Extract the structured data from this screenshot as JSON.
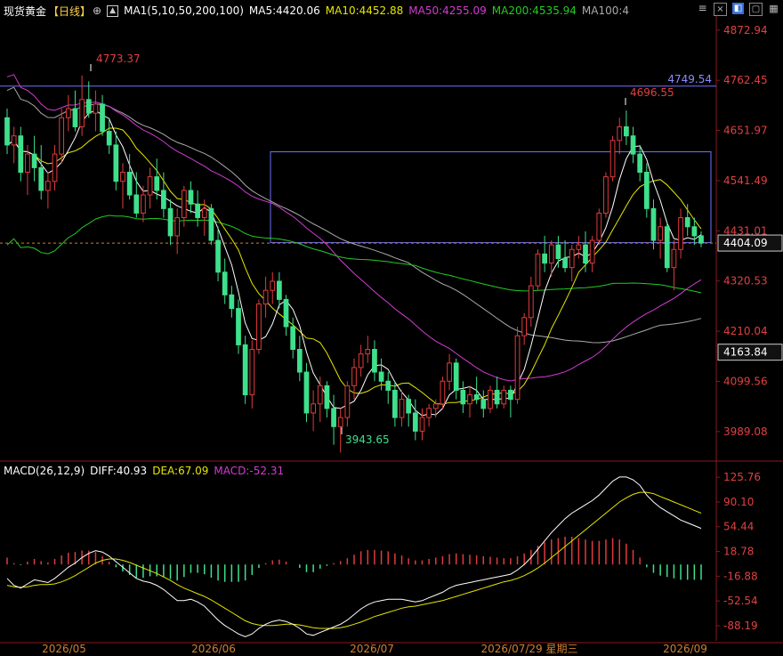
{
  "header": {
    "symbol": "现货黄金",
    "period": "【日线】",
    "ma_params": "MA1(5,10,50,200,100)",
    "ma5": "MA5:4420.06",
    "ma10": "MA10:4452.88",
    "ma50": "MA50:4255.09",
    "ma200": "MA200:4535.94",
    "ma100": "MA100:4",
    "colors": {
      "ma5": "#ffffff",
      "ma10": "#e6e600",
      "ma50": "#d23cd2",
      "ma200": "#22cc22",
      "ma100": "#aaaaaa"
    }
  },
  "toolbar": {
    "icons": [
      "menu-icon",
      "close-box-icon",
      "collapse-icon",
      "expand-icon",
      "grid-icon"
    ]
  },
  "price_axis": {
    "ticks": [
      "4872.94",
      "4762.45",
      "4651.97",
      "4541.49",
      "4431.01",
      "4320.53",
      "4210.04",
      "4099.56",
      "3989.08"
    ],
    "current_price": "4404.09",
    "hline_label": "4749.54",
    "marker_4163": "4163.84"
  },
  "annotations": {
    "high1": "4773.37",
    "high2": "4696.55",
    "low": "3943.65"
  },
  "macd_header": {
    "params": "MACD(26,12,9)",
    "diff": "DIFF:40.93",
    "dea": "DEA:67.09",
    "macd": "MACD:-52.31"
  },
  "macd_axis": {
    "ticks": [
      "125.76",
      "90.10",
      "54.44",
      "18.78",
      "-16.88",
      "-52.54",
      "-88.19"
    ]
  },
  "time_axis": {
    "labels": [
      "2026/05",
      "2026/06",
      "2026/07",
      "2026/07/29 星期三",
      "2026/09"
    ]
  },
  "chart_data": {
    "type": "candlestick",
    "title": "现货黄金 【日线】",
    "ylim": [
      3930,
      4900
    ],
    "ohlc": [
      [
        4680,
        4700,
        4600,
        4620
      ],
      [
        4620,
        4660,
        4580,
        4640
      ],
      [
        4640,
        4660,
        4540,
        4560
      ],
      [
        4560,
        4620,
        4510,
        4600
      ],
      [
        4600,
        4640,
        4540,
        4570
      ],
      [
        4570,
        4620,
        4500,
        4520
      ],
      [
        4520,
        4560,
        4480,
        4540
      ],
      [
        4540,
        4620,
        4520,
        4600
      ],
      [
        4600,
        4700,
        4580,
        4680
      ],
      [
        4680,
        4730,
        4650,
        4700
      ],
      [
        4700,
        4740,
        4650,
        4660
      ],
      [
        4660,
        4773,
        4640,
        4720
      ],
      [
        4720,
        4760,
        4680,
        4690
      ],
      [
        4690,
        4740,
        4650,
        4710
      ],
      [
        4710,
        4730,
        4640,
        4650
      ],
      [
        4650,
        4680,
        4600,
        4620
      ],
      [
        4620,
        4650,
        4520,
        4540
      ],
      [
        4540,
        4580,
        4480,
        4560
      ],
      [
        4560,
        4600,
        4500,
        4510
      ],
      [
        4510,
        4560,
        4460,
        4470
      ],
      [
        4470,
        4530,
        4450,
        4510
      ],
      [
        4510,
        4570,
        4480,
        4550
      ],
      [
        4550,
        4590,
        4500,
        4520
      ],
      [
        4520,
        4560,
        4460,
        4480
      ],
      [
        4480,
        4500,
        4400,
        4420
      ],
      [
        4420,
        4480,
        4380,
        4460
      ],
      [
        4460,
        4530,
        4440,
        4520
      ],
      [
        4520,
        4540,
        4470,
        4490
      ],
      [
        4490,
        4520,
        4440,
        4460
      ],
      [
        4460,
        4500,
        4420,
        4480
      ],
      [
        4480,
        4490,
        4400,
        4410
      ],
      [
        4410,
        4440,
        4320,
        4340
      ],
      [
        4340,
        4370,
        4270,
        4290
      ],
      [
        4290,
        4310,
        4240,
        4260
      ],
      [
        4260,
        4280,
        4160,
        4180
      ],
      [
        4180,
        4200,
        4050,
        4070
      ],
      [
        4070,
        4190,
        4040,
        4170
      ],
      [
        4170,
        4280,
        4160,
        4270
      ],
      [
        4270,
        4330,
        4240,
        4300
      ],
      [
        4300,
        4340,
        4270,
        4320
      ],
      [
        4320,
        4340,
        4260,
        4280
      ],
      [
        4280,
        4290,
        4200,
        4220
      ],
      [
        4220,
        4240,
        4150,
        4170
      ],
      [
        4170,
        4200,
        4100,
        4120
      ],
      [
        4120,
        4140,
        4010,
        4030
      ],
      [
        4030,
        4080,
        3990,
        4050
      ],
      [
        4050,
        4110,
        4010,
        4090
      ],
      [
        4090,
        4100,
        4020,
        4040
      ],
      [
        4040,
        4070,
        3960,
        4000
      ],
      [
        4000,
        4040,
        3943,
        4020
      ],
      [
        4020,
        4100,
        4000,
        4090
      ],
      [
        4090,
        4150,
        4060,
        4130
      ],
      [
        4130,
        4180,
        4110,
        4160
      ],
      [
        4160,
        4200,
        4140,
        4170
      ],
      [
        4170,
        4190,
        4100,
        4120
      ],
      [
        4120,
        4150,
        4080,
        4100
      ],
      [
        4100,
        4120,
        4050,
        4080
      ],
      [
        4080,
        4100,
        4000,
        4020
      ],
      [
        4020,
        4080,
        4000,
        4060
      ],
      [
        4060,
        4070,
        4000,
        4030
      ],
      [
        4030,
        4060,
        3970,
        3990
      ],
      [
        3990,
        4040,
        3970,
        4020
      ],
      [
        4020,
        4050,
        4000,
        4040
      ],
      [
        4040,
        4060,
        4020,
        4050
      ],
      [
        4050,
        4110,
        4040,
        4100
      ],
      [
        4100,
        4160,
        4080,
        4140
      ],
      [
        4140,
        4150,
        4060,
        4080
      ],
      [
        4080,
        4100,
        4030,
        4050
      ],
      [
        4050,
        4090,
        4020,
        4070
      ],
      [
        4070,
        4110,
        4050,
        4060
      ],
      [
        4060,
        4080,
        4020,
        4040
      ],
      [
        4040,
        4090,
        4030,
        4080
      ],
      [
        4080,
        4110,
        4040,
        4050
      ],
      [
        4050,
        4090,
        4040,
        4080
      ],
      [
        4080,
        4090,
        4020,
        4060
      ],
      [
        4060,
        4220,
        4050,
        4200
      ],
      [
        4200,
        4250,
        4180,
        4240
      ],
      [
        4240,
        4330,
        4220,
        4310
      ],
      [
        4310,
        4390,
        4300,
        4380
      ],
      [
        4380,
        4420,
        4340,
        4360
      ],
      [
        4360,
        4410,
        4330,
        4400
      ],
      [
        4400,
        4420,
        4350,
        4370
      ],
      [
        4370,
        4410,
        4340,
        4350
      ],
      [
        4350,
        4400,
        4320,
        4390
      ],
      [
        4390,
        4420,
        4370,
        4400
      ],
      [
        4400,
        4430,
        4340,
        4360
      ],
      [
        4360,
        4420,
        4340,
        4410
      ],
      [
        4410,
        4480,
        4400,
        4470
      ],
      [
        4470,
        4560,
        4460,
        4550
      ],
      [
        4550,
        4640,
        4540,
        4630
      ],
      [
        4630,
        4680,
        4600,
        4660
      ],
      [
        4660,
        4696,
        4620,
        4640
      ],
      [
        4640,
        4660,
        4580,
        4600
      ],
      [
        4600,
        4620,
        4540,
        4560
      ],
      [
        4560,
        4580,
        4460,
        4480
      ],
      [
        4480,
        4500,
        4390,
        4410
      ],
      [
        4410,
        4460,
        4370,
        4440
      ],
      [
        4440,
        4450,
        4340,
        4350
      ],
      [
        4350,
        4410,
        4300,
        4390
      ],
      [
        4390,
        4480,
        4370,
        4460
      ],
      [
        4460,
        4490,
        4420,
        4440
      ],
      [
        4440,
        4460,
        4400,
        4420
      ],
      [
        4420,
        4430,
        4395,
        4404
      ]
    ],
    "hlines": [
      4749.54
    ],
    "rect_range": [
      4405,
      4605
    ],
    "macd": {
      "ylim": [
        -110,
        140
      ],
      "diff_line": [
        -20,
        -30,
        -34,
        -28,
        -22,
        -24,
        -26,
        -20,
        -12,
        -4,
        2,
        10,
        16,
        20,
        18,
        12,
        4,
        -4,
        -12,
        -20,
        -24,
        -26,
        -30,
        -36,
        -44,
        -52,
        -52,
        -50,
        -54,
        -60,
        -70,
        -80,
        -88,
        -94,
        -100,
        -104,
        -100,
        -92,
        -86,
        -82,
        -80,
        -82,
        -86,
        -92,
        -100,
        -102,
        -98,
        -94,
        -90,
        -86,
        -80,
        -72,
        -64,
        -58,
        -54,
        -52,
        -50,
        -50,
        -50,
        -52,
        -54,
        -52,
        -48,
        -44,
        -40,
        -34,
        -30,
        -28,
        -26,
        -24,
        -22,
        -20,
        -18,
        -16,
        -14,
        -8,
        0,
        10,
        22,
        34,
        46,
        56,
        66,
        74,
        80,
        86,
        92,
        100,
        110,
        120,
        126,
        126,
        122,
        114,
        100,
        90,
        82,
        76,
        70,
        64,
        60,
        56,
        52
      ],
      "dea_line": [
        -30,
        -32,
        -33,
        -32,
        -30,
        -29,
        -29,
        -28,
        -25,
        -21,
        -16,
        -10,
        -4,
        2,
        6,
        8,
        8,
        6,
        3,
        -1,
        -5,
        -9,
        -13,
        -18,
        -23,
        -29,
        -34,
        -38,
        -42,
        -46,
        -51,
        -57,
        -63,
        -69,
        -75,
        -81,
        -85,
        -87,
        -88,
        -88,
        -87,
        -86,
        -86,
        -87,
        -89,
        -91,
        -92,
        -92,
        -92,
        -91,
        -89,
        -86,
        -83,
        -79,
        -75,
        -72,
        -69,
        -66,
        -63,
        -61,
        -60,
        -58,
        -56,
        -54,
        -52,
        -49,
        -46,
        -43,
        -40,
        -37,
        -34,
        -31,
        -28,
        -25,
        -23,
        -20,
        -16,
        -11,
        -5,
        2,
        10,
        18,
        26,
        34,
        42,
        50,
        58,
        66,
        74,
        82,
        90,
        96,
        101,
        104,
        104,
        102,
        98,
        94,
        90,
        86,
        82,
        78,
        74
      ],
      "hist": [
        10,
        2,
        -1,
        4,
        8,
        5,
        3,
        8,
        13,
        17,
        18,
        20,
        20,
        18,
        12,
        4,
        -4,
        -10,
        -15,
        -19,
        -19,
        -17,
        -17,
        -18,
        -21,
        -23,
        -18,
        -12,
        -12,
        -14,
        -19,
        -23,
        -25,
        -25,
        -25,
        -23,
        -15,
        -5,
        2,
        6,
        7,
        4,
        0,
        -5,
        -11,
        -11,
        -6,
        -2,
        2,
        5,
        9,
        14,
        19,
        21,
        21,
        20,
        19,
        16,
        13,
        9,
        6,
        6,
        8,
        10,
        12,
        15,
        16,
        15,
        14,
        13,
        12,
        11,
        10,
        9,
        9,
        12,
        16,
        21,
        27,
        32,
        36,
        38,
        40,
        40,
        38,
        36,
        34,
        34,
        36,
        38,
        36,
        30,
        21,
        10,
        -4,
        -12,
        -16,
        -18,
        -20,
        -22,
        -22,
        -22,
        -22
      ]
    }
  }
}
